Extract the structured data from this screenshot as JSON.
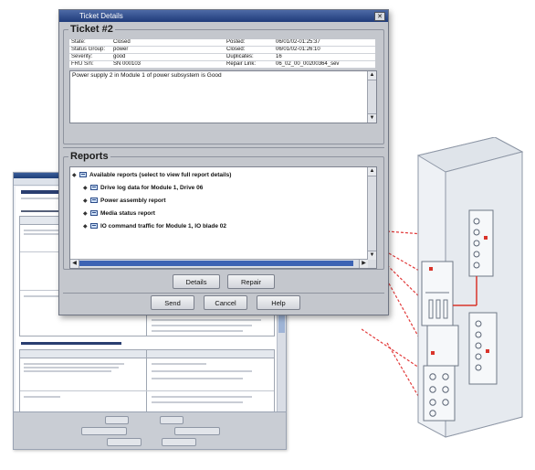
{
  "dialog": {
    "title": "Ticket Details",
    "close_glyph": "✕",
    "ticket_group_label": "Ticket #2",
    "fields": [
      {
        "label": "State:",
        "value": "Closed",
        "label2": "Posted:",
        "value2": "06/01/02-01:25:37"
      },
      {
        "label": "Status Group:",
        "value": "power",
        "label2": "Closed:",
        "value2": "06/01/02-01:26:10"
      },
      {
        "label": "Severity:",
        "value": "good",
        "label2": "Duplicates:",
        "value2": "16"
      },
      {
        "label": "FRU S/n:",
        "value": "SN 000103",
        "label2": "Repair Link:",
        "value2": "06_02_00_00200364_sev"
      }
    ],
    "description": "Power supply 2 in Module 1 of power subsystem is Good",
    "reports_group_label": "Reports",
    "reports_root": "Available reports (select to view full report details)",
    "reports": [
      "Drive log data for Module 1, Drive 06",
      "Power assembly report",
      "Media status report",
      "IO command traffic for Module 1, IO blade 02"
    ],
    "buttons": {
      "details": "Details",
      "repair": "Repair",
      "send": "Send",
      "cancel": "Cancel",
      "help": "Help"
    }
  },
  "icons": {
    "tree_toggle": "◆",
    "arrow_up": "▲",
    "arrow_down": "▼",
    "arrow_left": "◀",
    "arrow_right": "▶"
  },
  "colors": {
    "dialog_bg": "#c4c7cd",
    "titlebar": "#1f3b7a",
    "scroll_thumb": "#3d63b4",
    "callout": "#e23b3b"
  }
}
